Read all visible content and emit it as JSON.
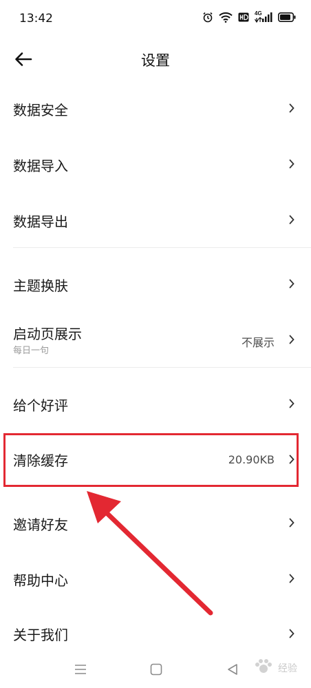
{
  "status_bar": {
    "time": "13:42",
    "network": "4G"
  },
  "header": {
    "title": "设置"
  },
  "settings": {
    "data_security": "数据安全",
    "data_import": "数据导入",
    "data_export": "数据导出",
    "theme": "主题换肤",
    "splash": {
      "label": "启动页展示",
      "sub": "每日一句",
      "value": "不展示"
    },
    "rate": "给个好评",
    "clear_cache": {
      "label": "清除缓存",
      "value": "20.90KB"
    },
    "invite": "邀请好友",
    "help": "帮助中心",
    "about": "关于我们"
  },
  "watermark": "经验",
  "colors": {
    "annotation": "#e32832",
    "divider": "#ececec",
    "secondary_text": "#9a9a9a"
  },
  "icons": [
    "alarm-icon",
    "wifi-icon",
    "hd-icon",
    "signal-icon",
    "battery-icon",
    "back-arrow-icon",
    "chevron-right-icon",
    "menu-icon",
    "home-icon",
    "back-triangle-icon"
  ]
}
